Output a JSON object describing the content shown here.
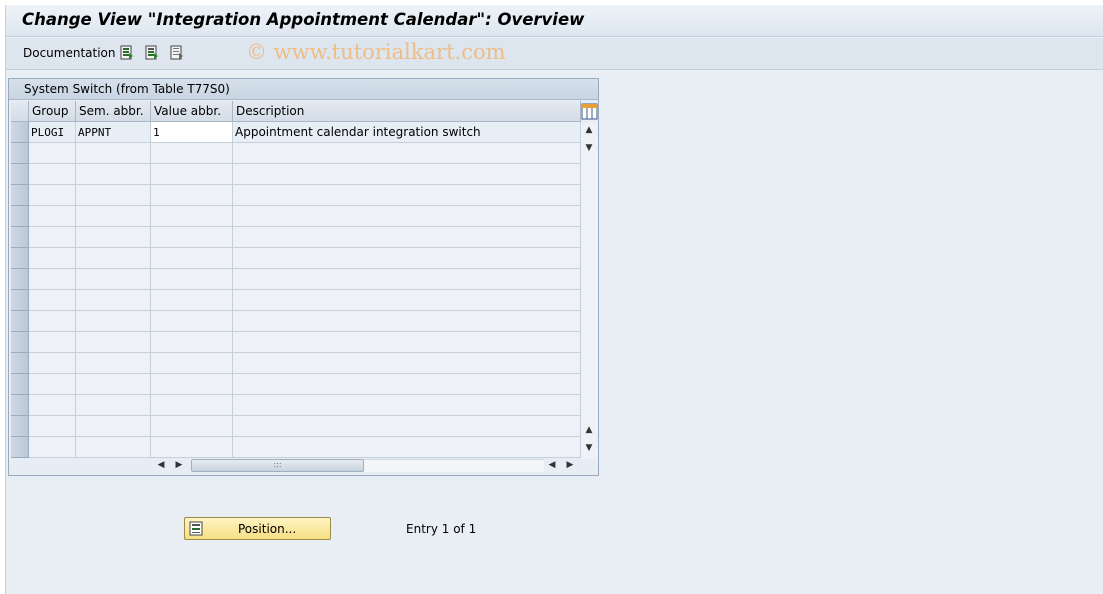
{
  "window": {
    "title": "Change View \"Integration Appointment Calendar\": Overview"
  },
  "toolbar": {
    "documentation_label": "Documentation",
    "icons": [
      "select-all-icon",
      "select-block-icon",
      "deselect-all-icon"
    ],
    "watermark": "© www.tutorialkart.com"
  },
  "panel": {
    "title": "System Switch (from Table T77S0)",
    "columns": [
      "Group",
      "Sem. abbr.",
      "Value abbr.",
      "Description"
    ],
    "rows": [
      {
        "group": "PLOGI",
        "sem": "APPNT",
        "value": "1",
        "description": "Appointment calendar integration switch"
      }
    ],
    "empty_rows": 15
  },
  "footer": {
    "position_button": "Position...",
    "entry_text": "Entry 1 of 1"
  },
  "colors": {
    "accent_button": "#f6df82",
    "watermark": "#f0b97a"
  }
}
